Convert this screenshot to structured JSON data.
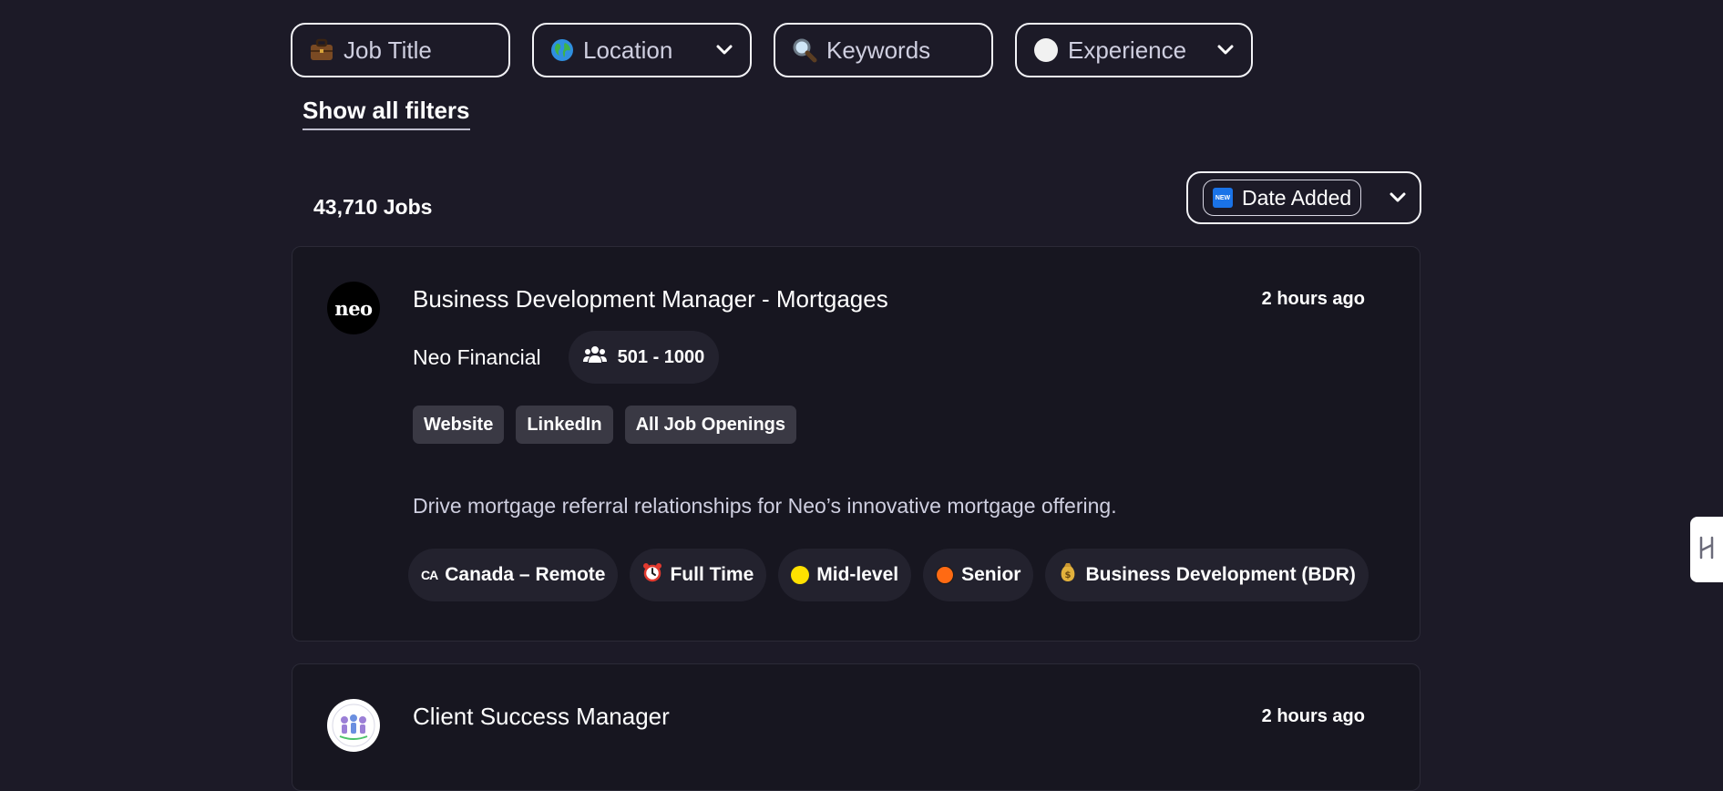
{
  "filters": {
    "job_title": {
      "icon": "briefcase-icon",
      "placeholder": "Job Title"
    },
    "location": {
      "icon": "globe-icon",
      "placeholder": "Location"
    },
    "keywords": {
      "icon": "search-icon",
      "placeholder": "Keywords"
    },
    "experience": {
      "icon": "circle-icon",
      "placeholder": "Experience"
    },
    "show_all": "Show all filters"
  },
  "results": {
    "count": "43,710 Jobs",
    "sort": {
      "icon": "new-badge-icon",
      "badge_text": "NEW",
      "label": "Date Added"
    }
  },
  "jobs": [
    {
      "title": "Business Development Manager - Mortgages",
      "posted": "2 hours ago",
      "company": "Neo Financial",
      "logo_text": "neo",
      "company_size": "501 - 1000",
      "links": [
        "Website",
        "LinkedIn",
        "All Job Openings"
      ],
      "description": "Drive mortgage referral relationships for Neo’s innovative mortgage offering.",
      "tags": [
        {
          "icon": "ca-flag-icon",
          "flag_text": "CA",
          "label": "Canada – Remote"
        },
        {
          "icon": "alarm-clock-icon",
          "label": "Full Time"
        },
        {
          "icon": "yellow-dot-icon",
          "label": "Mid-level"
        },
        {
          "icon": "orange-dot-icon",
          "label": "Senior"
        },
        {
          "icon": "money-bag-icon",
          "label": "Business Development (BDR)"
        }
      ]
    },
    {
      "title": "Client Success Manager",
      "posted": "2 hours ago"
    }
  ],
  "colors": {
    "background": "#1c1a27",
    "card": "#171620",
    "pill": "#23222e",
    "link_tag": "#3a3944"
  }
}
